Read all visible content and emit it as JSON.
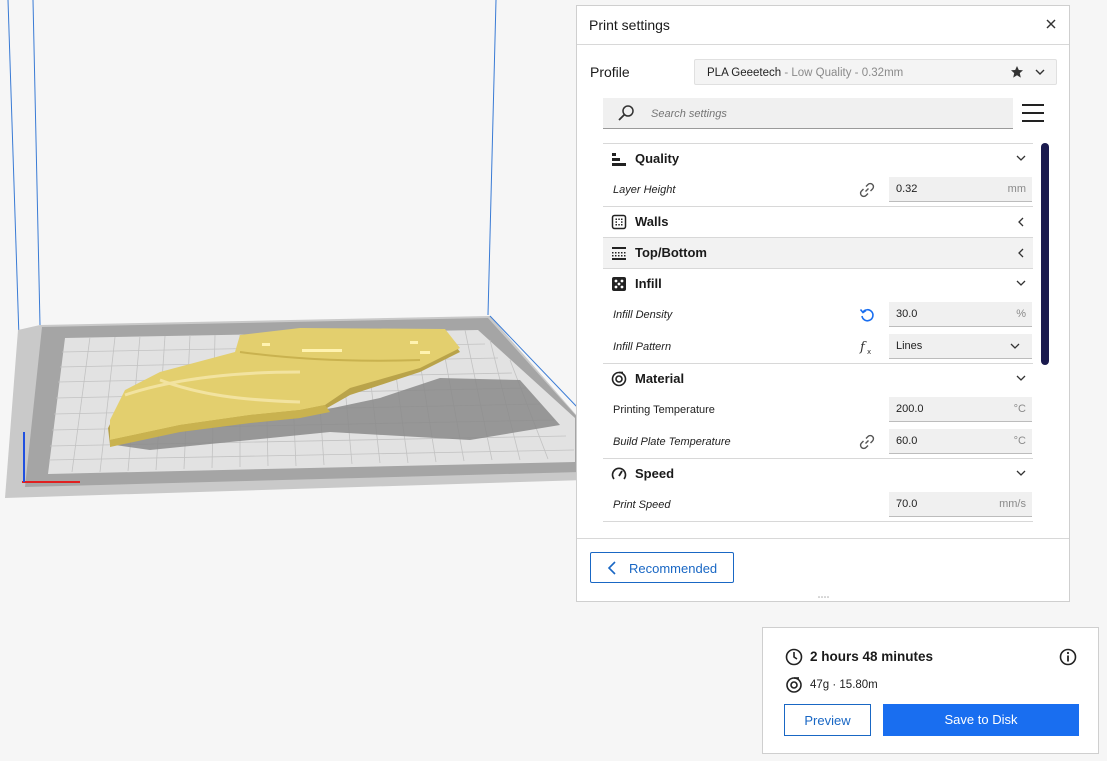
{
  "viewport": {
    "colors": {
      "model": "#e3cf6e",
      "model_shadow": "#b9a34a",
      "plate": "#cfcfcf",
      "plate_border": "#9d9d9d",
      "build_volume_edge": "#3a7bd5"
    }
  },
  "print_settings": {
    "title": "Print settings",
    "profile": {
      "label": "Profile",
      "name": "PLA Geeetech",
      "quality": " - Low Quality - 0.32mm"
    },
    "search": {
      "placeholder": "Search settings"
    },
    "categories": {
      "quality": {
        "label": "Quality",
        "settings": {
          "layer_height": {
            "label": "Layer Height",
            "value": "0.32",
            "unit": "mm"
          }
        }
      },
      "walls": {
        "label": "Walls"
      },
      "top_bottom": {
        "label": "Top/Bottom"
      },
      "infill": {
        "label": "Infill",
        "settings": {
          "infill_density": {
            "label": "Infill Density",
            "value": "30.0",
            "unit": "%"
          },
          "infill_pattern": {
            "label": "Infill Pattern",
            "value": "Lines"
          }
        }
      },
      "material": {
        "label": "Material",
        "settings": {
          "printing_temperature": {
            "label": "Printing Temperature",
            "value": "200.0",
            "unit": "°C"
          },
          "build_plate_temperature": {
            "label": "Build Plate Temperature",
            "value": "60.0",
            "unit": "°C"
          }
        }
      },
      "speed": {
        "label": "Speed",
        "settings": {
          "print_speed": {
            "label": "Print Speed",
            "value": "70.0",
            "unit": "mm/s"
          }
        }
      }
    },
    "recommended_label": "Recommended"
  },
  "print_info": {
    "time": "2 hours 48 minutes",
    "material": "47g · 15.80m",
    "preview_label": "Preview",
    "save_label": "Save to Disk"
  },
  "colors": {
    "accent": "#196ef0",
    "accent_outline": "#1967c4",
    "scrollbar": "#1a1a4e"
  }
}
